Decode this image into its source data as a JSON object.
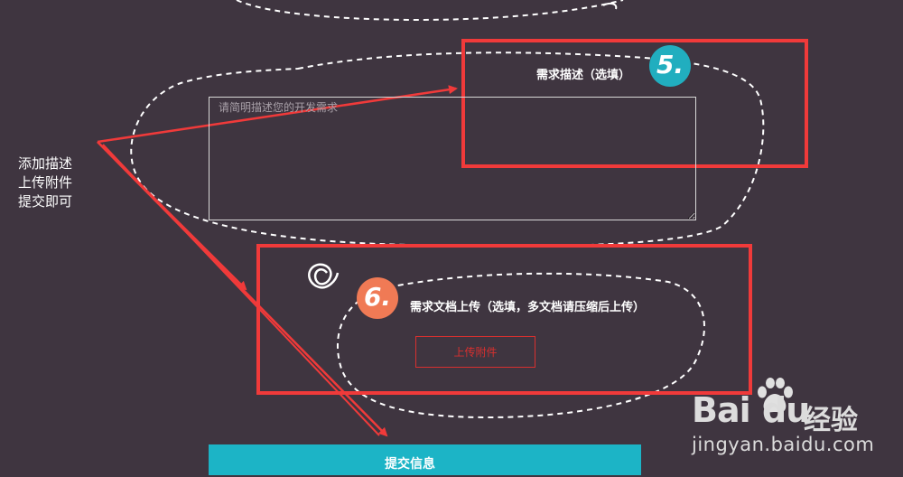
{
  "form": {
    "description": {
      "step_number": "5.",
      "label": "需求描述（选填）",
      "placeholder": "请简明描述您的开发需求"
    },
    "attachment": {
      "step_number": "6.",
      "label": "需求文档上传（选填，多文档请压缩后上传）",
      "upload_button": "上传附件"
    },
    "submit_label": "提交信息"
  },
  "annotation": {
    "lines": [
      "添加描述",
      "上传附件",
      "提交即可"
    ]
  },
  "watermark": {
    "brand_latin": "Bai",
    "brand_du": "du",
    "brand_cn": "经验",
    "url": "jingyan.baidu.com"
  },
  "colors": {
    "background": "#3f3540",
    "highlight_red": "#f03a3a",
    "badge_five": "#21aebf",
    "badge_six": "#f07a55",
    "submit_bar": "#1cb4c6"
  }
}
